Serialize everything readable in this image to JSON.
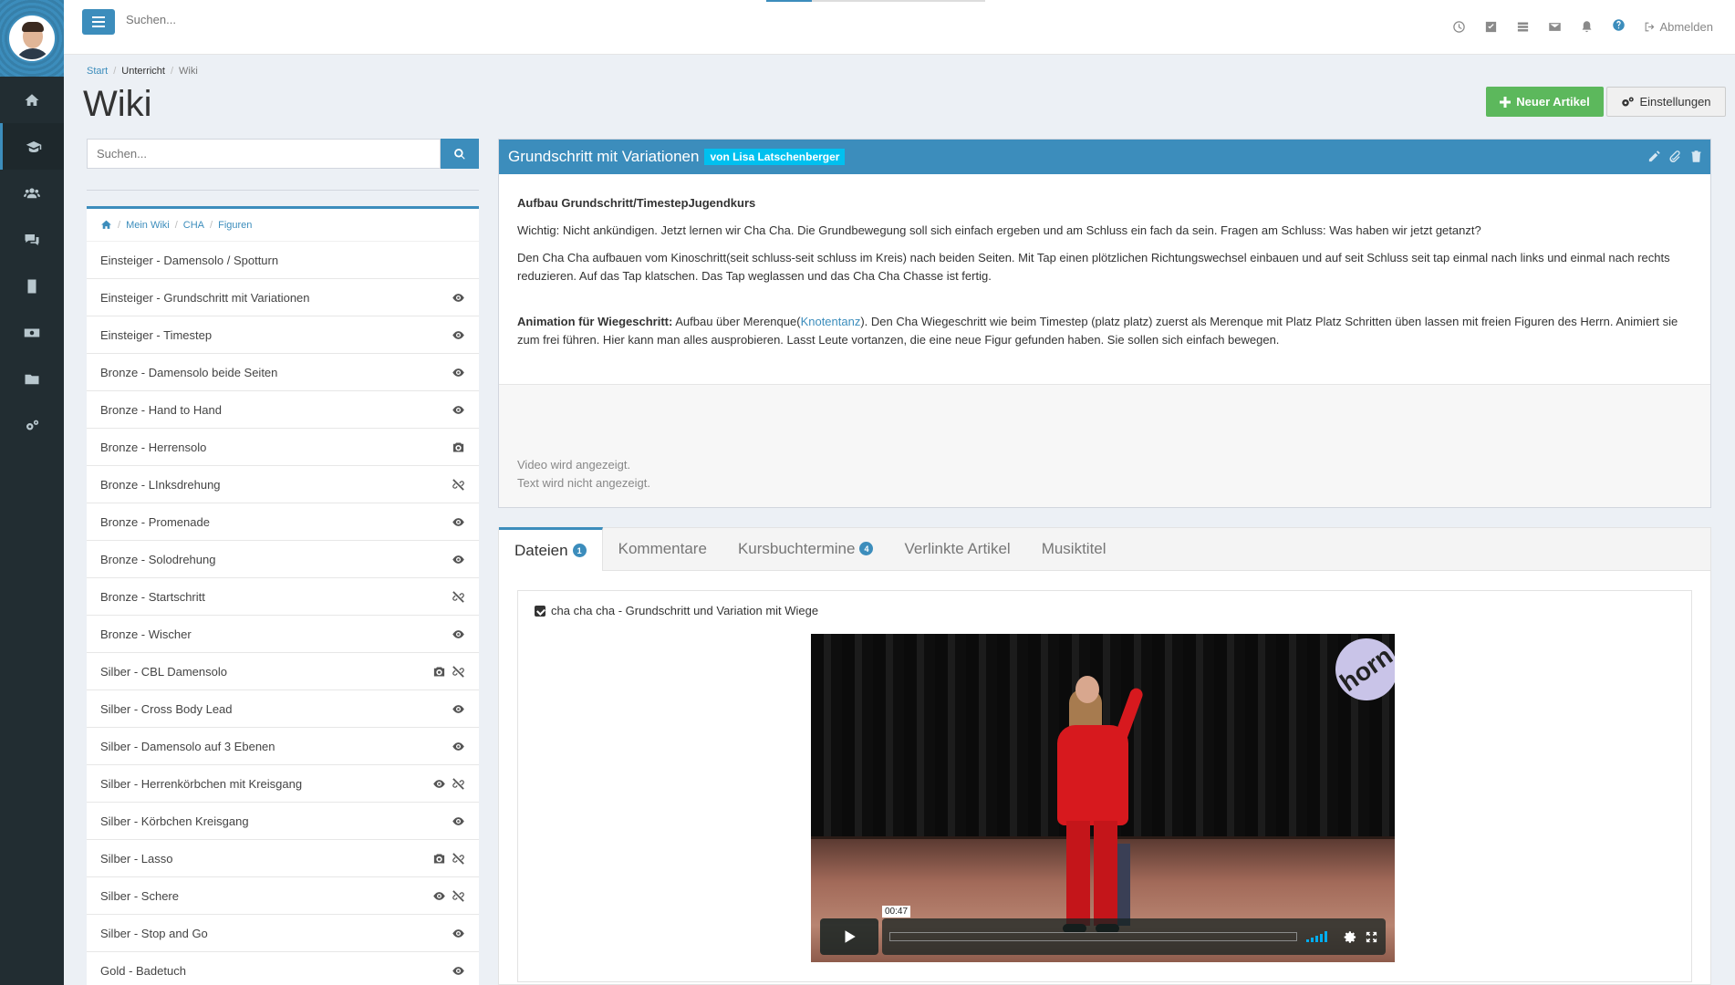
{
  "topbar": {
    "search_placeholder": "Suchen...",
    "logout_label": "Abmelden",
    "icons": [
      "clock-icon",
      "checkbox-icon",
      "list-icon",
      "envelope-icon",
      "bell-icon",
      "help-icon"
    ]
  },
  "sidebar": {
    "items": [
      {
        "name": "home",
        "icon": "home-icon"
      },
      {
        "name": "unterricht",
        "icon": "graduation-cap-icon",
        "active": true
      },
      {
        "name": "users",
        "icon": "users-icon"
      },
      {
        "name": "comments",
        "icon": "comments-icon"
      },
      {
        "name": "book",
        "icon": "book-icon"
      },
      {
        "name": "money",
        "icon": "money-icon"
      },
      {
        "name": "folder",
        "icon": "folder-icon"
      },
      {
        "name": "settings",
        "icon": "cogs-icon"
      }
    ]
  },
  "breadcrumb": {
    "start": "Start",
    "unterricht": "Unterricht",
    "wiki": "Wiki"
  },
  "page": {
    "title": "Wiki",
    "new_button": "Neuer Artikel",
    "settings_button": "Einstellungen"
  },
  "left": {
    "search_placeholder": "Suchen...",
    "crumb": {
      "mein_wiki": "Mein Wiki",
      "cha": "CHA",
      "figuren": "Figuren"
    },
    "items": [
      {
        "label": "Einsteiger - Damensolo / Spotturn",
        "icons": []
      },
      {
        "label": "Einsteiger - Grundschritt mit Variationen",
        "icons": [
          "eye-icon"
        ]
      },
      {
        "label": "Einsteiger - Timestep",
        "icons": [
          "eye-icon"
        ]
      },
      {
        "label": "Bronze - Damensolo beide Seiten",
        "icons": [
          "eye-icon"
        ]
      },
      {
        "label": "Bronze - Hand to Hand",
        "icons": [
          "eye-icon"
        ]
      },
      {
        "label": "Bronze - Herrensolo",
        "icons": [
          "camera-icon"
        ]
      },
      {
        "label": "Bronze - LInksdrehung",
        "icons": [
          "unlink-icon"
        ]
      },
      {
        "label": "Bronze - Promenade",
        "icons": [
          "eye-icon"
        ]
      },
      {
        "label": "Bronze - Solodrehung",
        "icons": [
          "eye-icon"
        ]
      },
      {
        "label": "Bronze - Startschritt",
        "icons": [
          "unlink-icon"
        ]
      },
      {
        "label": "Bronze - Wischer",
        "icons": [
          "eye-icon"
        ]
      },
      {
        "label": "Silber - CBL Damensolo",
        "icons": [
          "camera-icon",
          "unlink-icon"
        ]
      },
      {
        "label": "Silber - Cross Body Lead",
        "icons": [
          "eye-icon"
        ]
      },
      {
        "label": "Silber - Damensolo auf 3 Ebenen",
        "icons": [
          "eye-icon"
        ]
      },
      {
        "label": "Silber - Herrenkörbchen mit Kreisgang",
        "icons": [
          "eye-icon",
          "unlink-icon"
        ]
      },
      {
        "label": "Silber - Körbchen Kreisgang",
        "icons": [
          "eye-icon"
        ]
      },
      {
        "label": "Silber - Lasso",
        "icons": [
          "camera-icon",
          "unlink-icon"
        ]
      },
      {
        "label": "Silber - Schere",
        "icons": [
          "eye-icon",
          "unlink-icon"
        ]
      },
      {
        "label": "Silber - Stop and Go",
        "icons": [
          "eye-icon"
        ]
      },
      {
        "label": "Gold - Badetuch",
        "icons": [
          "eye-icon"
        ]
      }
    ]
  },
  "article": {
    "title": "Grundschritt mit Variationen",
    "author": "von Lisa Latschenberger",
    "heading": "Aufbau Grundschritt/TimestepJugendkurs",
    "p1": "Wichtig: Nicht ankündigen. Jetzt lernen wir Cha Cha. Die Grundbewegung soll sich einfach ergeben und am Schluss ein fach da sein. Fragen am Schluss: Was haben wir jetzt getanzt?",
    "p2": "Den Cha Cha aufbauen vom Kinoschritt(seit schluss-seit schluss im Kreis) nach beiden Seiten. Mit Tap einen plötzlichen Richtungswechsel einbauen und auf seit Schluss seit tap einmal nach links und einmal nach rechts reduzieren. Auf das Tap klatschen. Das Tap weglassen und das Cha Cha Chasse ist fertig.",
    "p3_bold": "Animation für Wiegeschritt:",
    "p3_a": " Aufbau über Merenque(",
    "p3_link": "Knotentanz",
    "p3_b": "). Den Cha Wiegeschritt wie beim Timestep (platz platz) zuerst als Merenque mit Platz Platz Schritten üben lassen mit freien Figuren des Herrn. Animiert sie zum frei führen. Hier kann man alles ausprobieren. Lasst Leute vortanzen, die eine neue Figur gefunden haben. Sie sollen sich einfach bewegen.",
    "note1": "Video wird angezeigt.",
    "note2": "Text wird nicht angezeigt."
  },
  "tabs": [
    {
      "label": "Dateien",
      "badge": "1",
      "active": true
    },
    {
      "label": "Kommentare"
    },
    {
      "label": "Kursbuchtermine",
      "badge": "4"
    },
    {
      "label": "Verlinkte Artikel"
    },
    {
      "label": "Musiktitel"
    }
  ],
  "file": {
    "title": "cha cha cha - Grundschritt und Variation mit Wiege",
    "video_time": "00:47",
    "logo_text": "horn",
    "progress": 0
  },
  "colors": {
    "primary": "#3c8dbc",
    "success": "#5cb85c",
    "info": "#00c0ef",
    "sidebar": "#222d32"
  }
}
